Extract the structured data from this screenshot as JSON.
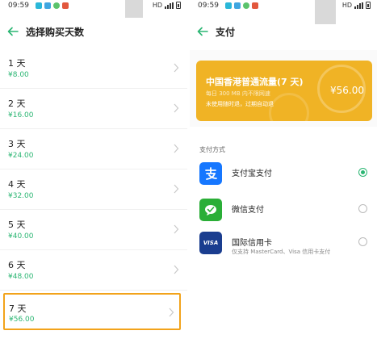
{
  "status_bar": {
    "time": "09:59",
    "network": "HD"
  },
  "left": {
    "title": "选择购买天数",
    "days": [
      {
        "label": "1 天",
        "price": "¥8.00"
      },
      {
        "label": "2 天",
        "price": "¥16.00"
      },
      {
        "label": "3 天",
        "price": "¥24.00"
      },
      {
        "label": "4 天",
        "price": "¥32.00"
      },
      {
        "label": "5 天",
        "price": "¥40.00"
      },
      {
        "label": "6 天",
        "price": "¥48.00"
      },
      {
        "label": "7 天",
        "price": "¥56.00"
      }
    ],
    "selected_index": 6
  },
  "right": {
    "title": "支付",
    "card": {
      "title": "中国香港普通流量(7 天)",
      "price": "¥56.00",
      "sub1": "每日 300 MB 内不限网速",
      "sub2": "未使用随时退，过期自动退"
    },
    "section_label": "支付方式",
    "methods": [
      {
        "name": "支付宝支付",
        "sub": "",
        "icon": "alipay-icon",
        "selected": true
      },
      {
        "name": "微信支付",
        "sub": "",
        "icon": "wechat-icon",
        "selected": false
      },
      {
        "name": "国际信用卡",
        "sub": "仅支持 MasterCard、Visa 信用卡支付",
        "icon": "visa-card-icon",
        "selected": false
      }
    ],
    "visa_text": "VISA"
  },
  "colors": {
    "accent_green": "#2bb673",
    "highlight_orange": "#f2a31b",
    "card_yellow": "#f0b325",
    "alipay_blue": "#1677ff",
    "wechat_green": "#2aae37",
    "visa_blue": "#1a3d8f"
  }
}
